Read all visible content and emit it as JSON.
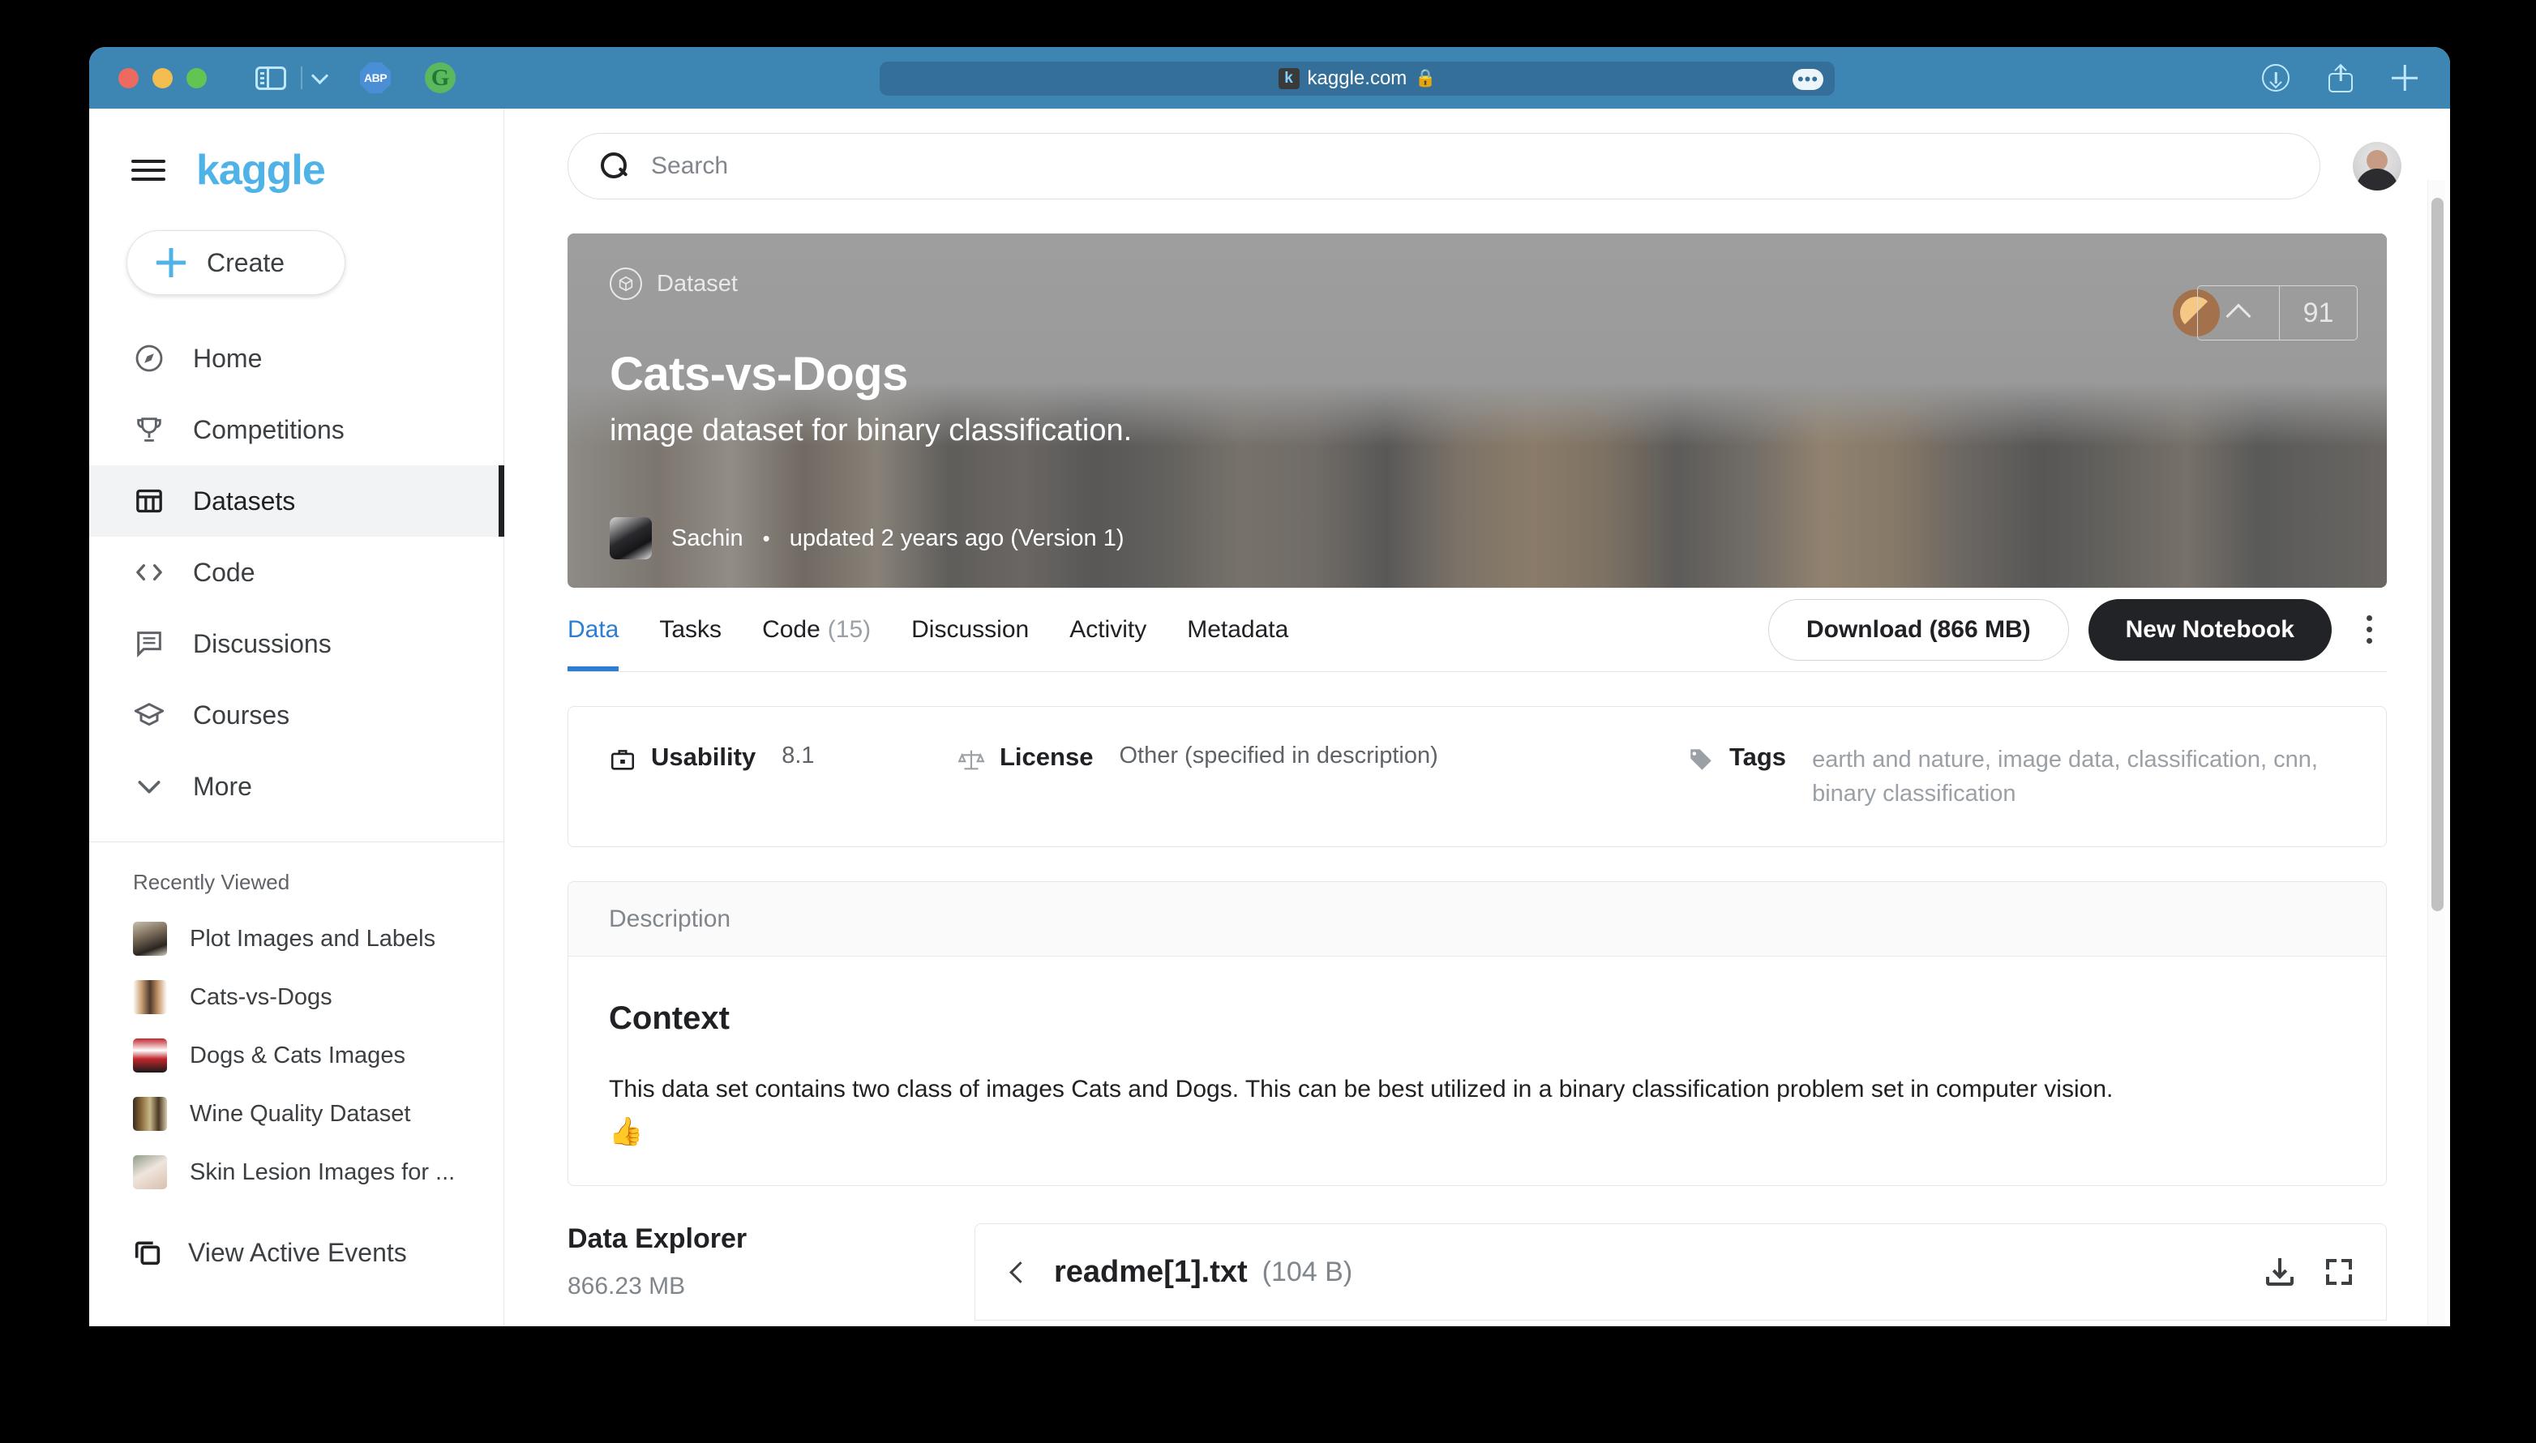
{
  "browser": {
    "url": "kaggle.com",
    "favicon_letter": "k",
    "lock_glyph": "🔒",
    "more_glyph": "•••",
    "extensions": [
      {
        "name": "adblock-plus",
        "label": "ABP"
      },
      {
        "name": "grammarly",
        "label": "G"
      }
    ]
  },
  "sidebar": {
    "logo": "kaggle",
    "create_label": "Create",
    "items": [
      {
        "label": "Home",
        "icon": "compass-icon",
        "active": false
      },
      {
        "label": "Competitions",
        "icon": "trophy-icon",
        "active": false
      },
      {
        "label": "Datasets",
        "icon": "table-icon",
        "active": true
      },
      {
        "label": "Code",
        "icon": "code-brackets-icon",
        "active": false
      },
      {
        "label": "Discussions",
        "icon": "comment-icon",
        "active": false
      },
      {
        "label": "Courses",
        "icon": "graduation-cap-icon",
        "active": false
      },
      {
        "label": "More",
        "icon": "chevron-down-icon",
        "active": false
      }
    ],
    "recent_title": "Recently Viewed",
    "recent_items": [
      {
        "label": "Plot Images and Labels"
      },
      {
        "label": "Cats-vs-Dogs"
      },
      {
        "label": "Dogs & Cats Images"
      },
      {
        "label": "Wine Quality Dataset"
      },
      {
        "label": "Skin Lesion Images for ..."
      }
    ],
    "view_active_events": "View Active Events"
  },
  "search": {
    "placeholder": "Search"
  },
  "banner": {
    "badge": "Dataset",
    "title": "Cats-vs-Dogs",
    "subtitle": "image dataset for binary classification.",
    "author": "Sachin",
    "separator": "•",
    "updated": "updated 2 years ago (Version 1)",
    "upvote_count": "91"
  },
  "tabs": [
    {
      "label": "Data",
      "count": "",
      "active": true
    },
    {
      "label": "Tasks",
      "count": "",
      "active": false
    },
    {
      "label": "Code",
      "count": "(15)",
      "active": false
    },
    {
      "label": "Discussion",
      "count": "",
      "active": false
    },
    {
      "label": "Activity",
      "count": "",
      "active": false
    },
    {
      "label": "Metadata",
      "count": "",
      "active": false
    }
  ],
  "actions": {
    "download_label": "Download (866 MB)",
    "new_notebook_label": "New Notebook"
  },
  "meta": {
    "usability_label": "Usability",
    "usability_value": "8.1",
    "license_label": "License",
    "license_value": "Other (specified in description)",
    "tags_label": "Tags",
    "tags_value": "earth and nature, image data, classification, cnn, binary classification"
  },
  "description": {
    "header": "Description",
    "heading": "Context",
    "text": "This data set contains two class of images Cats and Dogs. This can be best utilized in a binary classification problem set in computer vision.",
    "emoji": "👍"
  },
  "explorer": {
    "title": "Data Explorer",
    "size": "866.23 MB",
    "file_name": "readme[1].txt",
    "file_size": "(104 B)"
  },
  "colors": {
    "kaggle_blue": "#4fb3e8",
    "tab_active": "#2d7dd2",
    "safari_chrome": "#3d86b4",
    "dark_button": "#222326"
  }
}
